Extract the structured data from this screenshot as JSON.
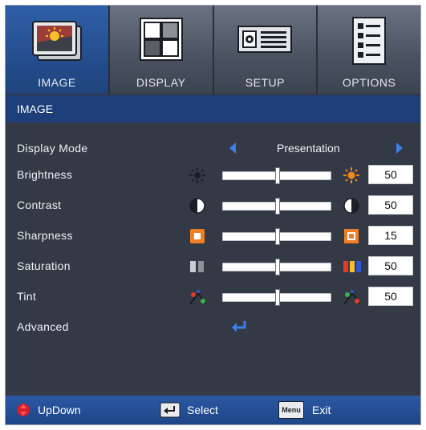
{
  "tabs": [
    {
      "label": "IMAGE",
      "icon": "image-icon",
      "active": true
    },
    {
      "label": "DISPLAY",
      "icon": "display-icon",
      "active": false
    },
    {
      "label": "SETUP",
      "icon": "setup-icon",
      "active": false
    },
    {
      "label": "OPTIONS",
      "icon": "options-icon",
      "active": false
    }
  ],
  "section_title": "IMAGE",
  "display_mode": {
    "label": "Display Mode",
    "value": "Presentation"
  },
  "settings": [
    {
      "label": "Brightness",
      "value": "50",
      "level": 0.5,
      "left_icon": "brightness-low-icon",
      "right_icon": "brightness-high-icon"
    },
    {
      "label": "Contrast",
      "value": "50",
      "level": 0.5,
      "left_icon": "contrast-low-icon",
      "right_icon": "contrast-high-icon"
    },
    {
      "label": "Sharpness",
      "value": "15",
      "level": 0.5,
      "left_icon": "sharpness-low-icon",
      "right_icon": "sharpness-high-icon"
    },
    {
      "label": "Saturation",
      "value": "50",
      "level": 0.5,
      "left_icon": "saturation-low-icon",
      "right_icon": "saturation-high-icon"
    },
    {
      "label": "Tint",
      "value": "50",
      "level": 0.5,
      "left_icon": "tint-low-icon",
      "right_icon": "tint-high-icon"
    }
  ],
  "advanced": {
    "label": "Advanced"
  },
  "footer": {
    "updown_label": "UpDown",
    "select_label": "Select",
    "menu_key": "Menu",
    "exit_label": "Exit"
  },
  "colors": {
    "accent": "#2f5fa8",
    "background": "#343946",
    "arrow": "#3d7fe6",
    "updown_button": "#d21f2a"
  }
}
